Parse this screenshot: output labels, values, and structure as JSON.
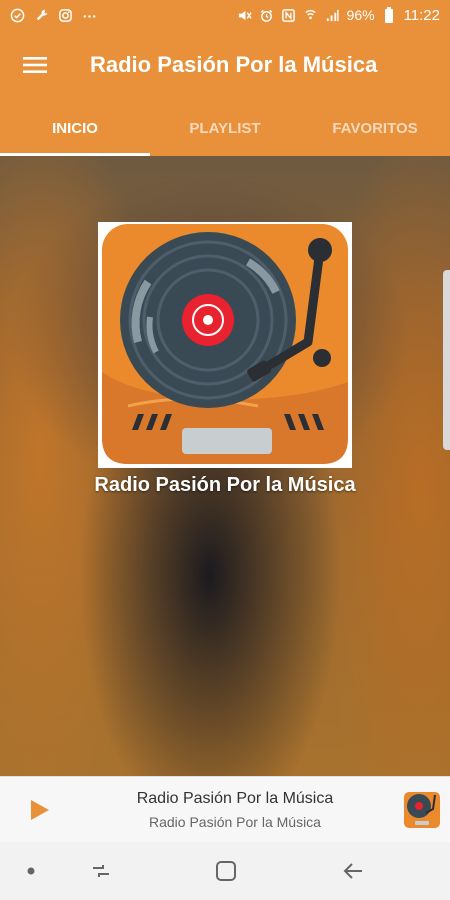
{
  "status_bar": {
    "left_icons": [
      "check-circle-icon",
      "wrench-icon",
      "instagram-icon",
      "more-icon"
    ],
    "battery": "96%",
    "time": "11:22"
  },
  "app_bar": {
    "title": "Radio Pasión Por la Música",
    "menu_icon": "menu-icon"
  },
  "tabs": [
    {
      "label": "INICIO",
      "active": true
    },
    {
      "label": "PLAYLIST",
      "active": false
    },
    {
      "label": "FAVORITOS",
      "active": false
    }
  ],
  "main": {
    "station_name": "Radio Pasión Por la Música",
    "logo_icon": "turntable-logo-icon"
  },
  "player": {
    "title": "Radio Pasión Por la Música",
    "subtitle": "Radio Pasión Por la Música",
    "play_icon": "play-icon"
  },
  "nav_bar": {
    "items": [
      "dot-icon",
      "recent-apps-icon",
      "home-icon",
      "back-icon"
    ]
  },
  "colors": {
    "primary": "#e8913a",
    "logo_orange": "#ea8a2c",
    "record": "#3a4a55",
    "record_label": "#e8222e"
  }
}
